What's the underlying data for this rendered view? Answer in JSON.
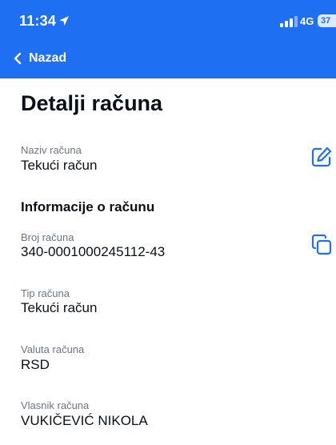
{
  "status_bar": {
    "time": "11:34",
    "network": "4G",
    "battery": "37"
  },
  "nav": {
    "back_label": "Nazad"
  },
  "page": {
    "title": "Detalji računa"
  },
  "account_name": {
    "label": "Naziv računa",
    "value": "Tekući račun"
  },
  "section_title": "Informacije o računu",
  "fields": [
    {
      "label": "Broj računa",
      "value": "340-0001000245112-43"
    },
    {
      "label": "Tip računa",
      "value": "Tekući račun"
    },
    {
      "label": "Valuta računa",
      "value": "RSD"
    },
    {
      "label": "Vlasnik računa",
      "value": "VUKIČEVIĆ NIKOLA"
    }
  ],
  "colors": {
    "header": "#1f6ff2",
    "icon": "#1f6ff2",
    "label": "#6d7584"
  }
}
